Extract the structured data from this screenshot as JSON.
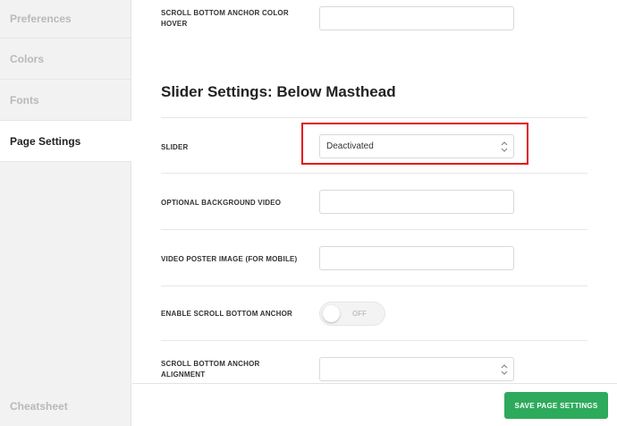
{
  "sidebar": {
    "items": [
      {
        "label": "Preferences"
      },
      {
        "label": "Colors"
      },
      {
        "label": "Fonts"
      },
      {
        "label": "Page Settings"
      }
    ],
    "footer_link": "Cheatsheet"
  },
  "main": {
    "top_field": {
      "label_line1": "SCROLL BOTTOM ANCHOR COLOR",
      "label_line2": "HOVER",
      "value": ""
    },
    "section_title": "Slider Settings: Below Masthead",
    "slider": {
      "label": "SLIDER",
      "value": "Deactivated"
    },
    "background_video": {
      "label": "OPTIONAL BACKGROUND VIDEO",
      "value": ""
    },
    "poster_image": {
      "label": "VIDEO POSTER IMAGE (FOR MOBILE)",
      "value": ""
    },
    "scroll_anchor": {
      "label": "ENABLE SCROLL BOTTOM ANCHOR",
      "state": "OFF"
    },
    "anchor_alignment": {
      "label_line1": "SCROLL BOTTOM ANCHOR",
      "label_line2": "ALIGNMENT",
      "value": ""
    }
  },
  "footer": {
    "save_label": "SAVE PAGE SETTINGS"
  },
  "colors": {
    "accent_green": "#2eaa5c",
    "highlight_red": "#e3141b"
  }
}
